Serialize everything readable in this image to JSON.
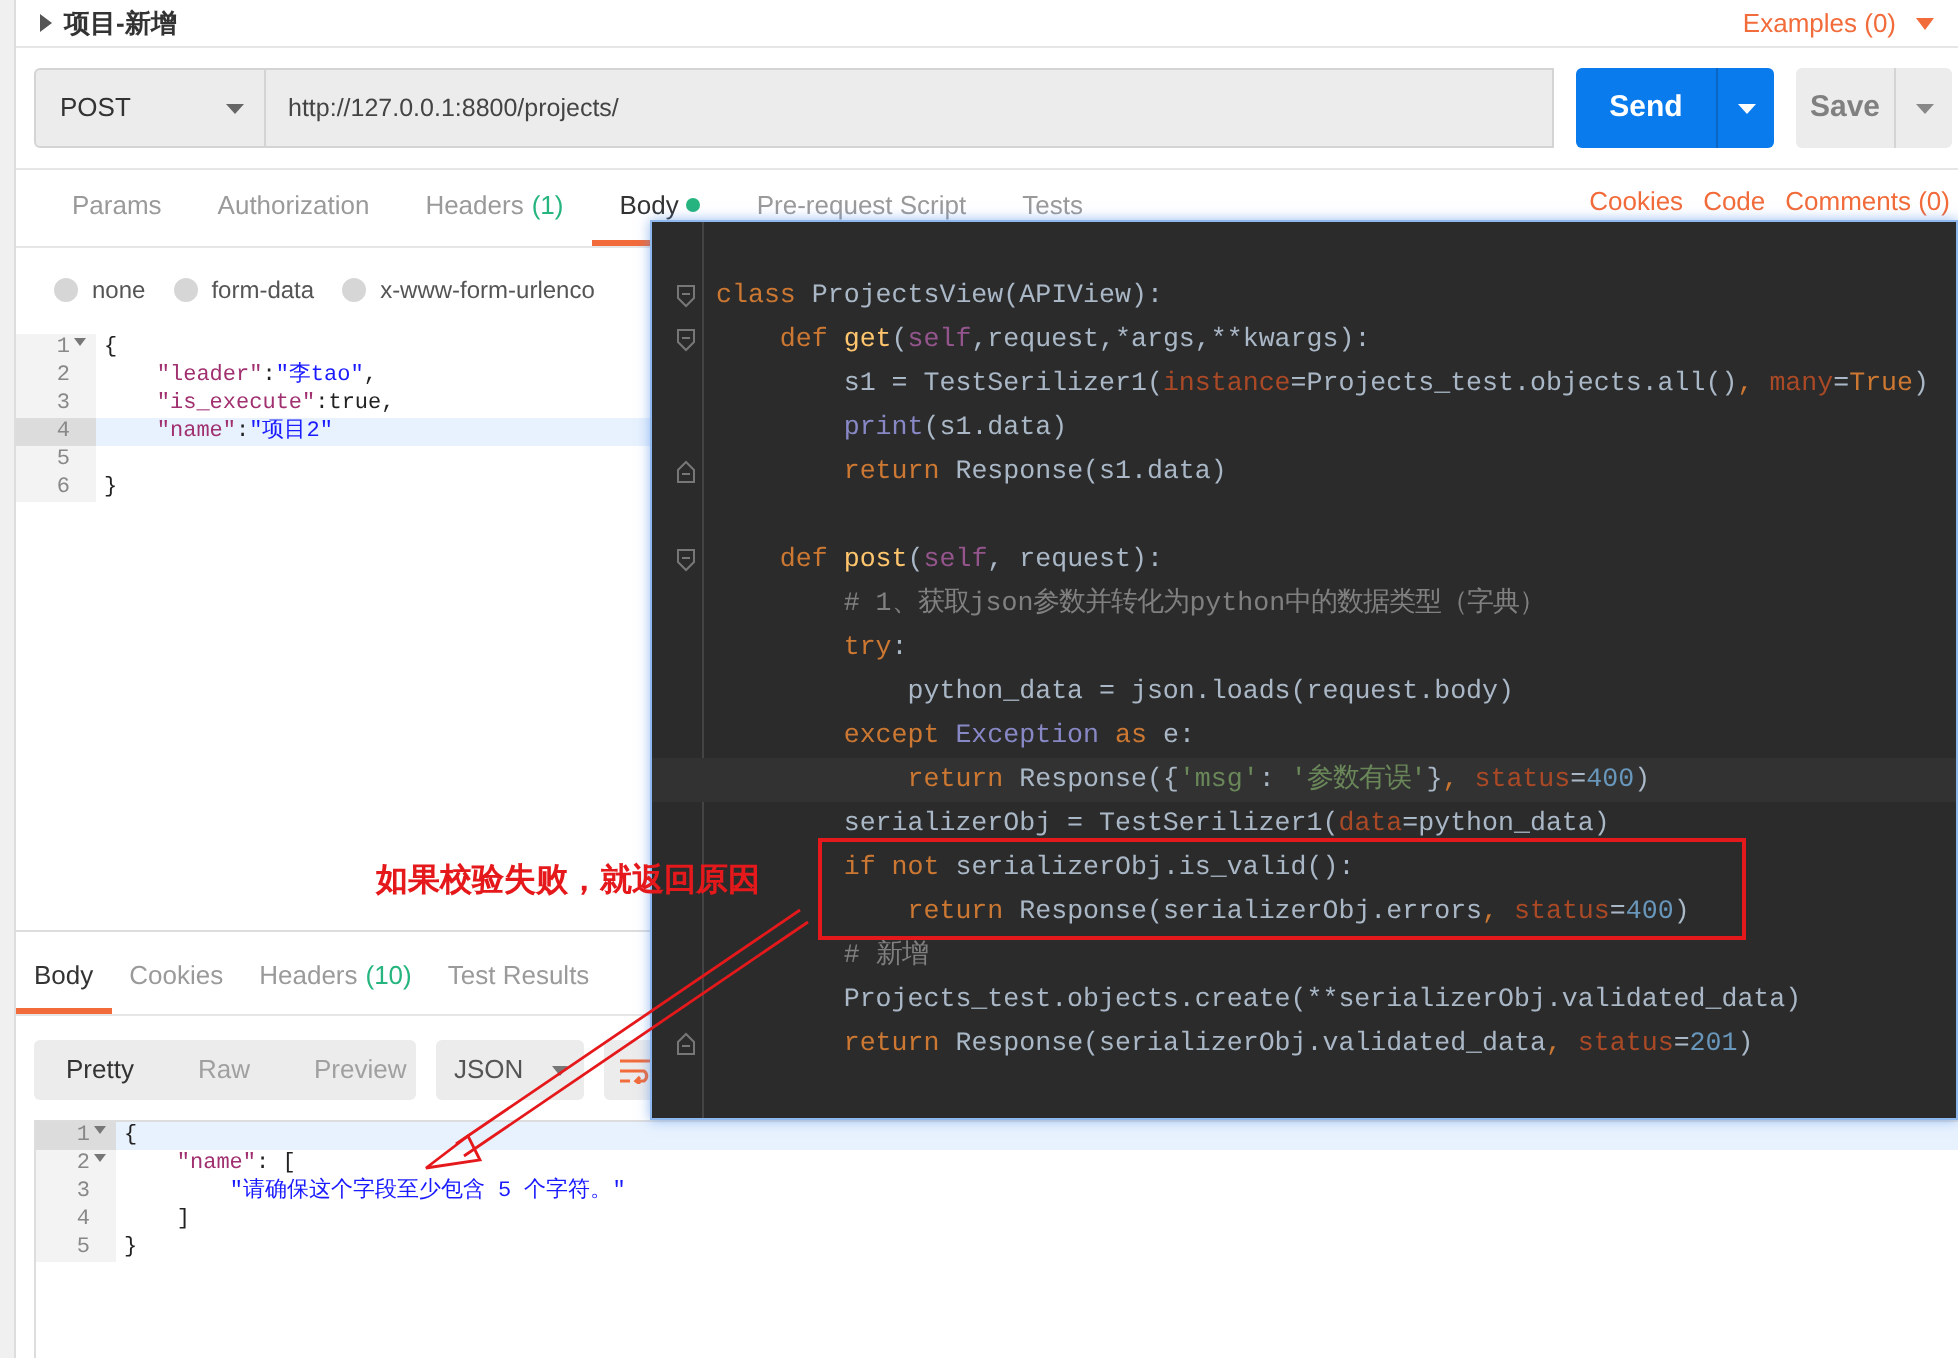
{
  "header": {
    "title": "项目-新增",
    "examples": "Examples (0)"
  },
  "request": {
    "method": "POST",
    "url": "http://127.0.0.1:8800/projects/",
    "send": "Send",
    "save": "Save"
  },
  "request_tabs": [
    {
      "label": "Params",
      "selected": false
    },
    {
      "label": "Authorization",
      "selected": false
    },
    {
      "label": "Headers",
      "count": "(1)",
      "selected": false
    },
    {
      "label": "Body",
      "modified": true,
      "selected": true
    },
    {
      "label": "Pre-request Script",
      "selected": false
    },
    {
      "label": "Tests",
      "selected": false
    }
  ],
  "request_links": [
    "Cookies",
    "Code",
    "Comments (0)"
  ],
  "body_types": [
    {
      "label": "none",
      "selected": false
    },
    {
      "label": "form-data",
      "selected": false
    },
    {
      "label": "x-www-form-urlenco",
      "selected": false
    }
  ],
  "request_body": [
    {
      "number": "1",
      "foldable": true,
      "highlighted": false,
      "kind": "code",
      "tokens": [
        {
          "kind": "plain",
          "text": "{"
        }
      ]
    },
    {
      "number": "2",
      "foldable": false,
      "highlighted": false,
      "kind": "code",
      "tokens": [
        {
          "kind": "key",
          "text": "    \"leader\""
        },
        {
          "kind": "plain",
          "text": ":"
        },
        {
          "kind": "str",
          "text": "\"李tao\""
        },
        {
          "kind": "plain",
          "text": ","
        }
      ]
    },
    {
      "number": "3",
      "foldable": false,
      "highlighted": false,
      "kind": "code",
      "tokens": [
        {
          "kind": "key",
          "text": "    \"is_execute\""
        },
        {
          "kind": "plain",
          "text": ":true,"
        }
      ]
    },
    {
      "number": "4",
      "foldable": false,
      "highlighted": true,
      "kind": "code",
      "tokens": [
        {
          "kind": "key",
          "text": "    \"name\""
        },
        {
          "kind": "plain",
          "text": ":"
        },
        {
          "kind": "str",
          "text": "\"项目2\""
        }
      ]
    },
    {
      "number": "5",
      "foldable": false,
      "highlighted": false,
      "kind": "blank"
    },
    {
      "number": "6",
      "foldable": false,
      "highlighted": false,
      "kind": "code",
      "tokens": [
        {
          "kind": "plain",
          "text": "}"
        }
      ]
    }
  ],
  "response_tabs": [
    {
      "label": "Body",
      "selected": true
    },
    {
      "label": "Cookies",
      "selected": false
    },
    {
      "label": "Headers",
      "count": "(10)",
      "selected": false
    },
    {
      "label": "Test Results",
      "selected": false
    }
  ],
  "view_modes": [
    {
      "label": "Pretty",
      "selected": true
    },
    {
      "label": "Raw",
      "selected": false
    },
    {
      "label": "Preview",
      "selected": false
    }
  ],
  "format": "JSON",
  "response_body": [
    {
      "number": "1",
      "foldable": true,
      "highlighted": true,
      "kind": "code",
      "tokens": [
        {
          "kind": "plain",
          "text": "{"
        }
      ]
    },
    {
      "number": "2",
      "foldable": true,
      "highlighted": false,
      "kind": "code",
      "tokens": [
        {
          "kind": "key",
          "text": "    \"name\""
        },
        {
          "kind": "plain",
          "text": ": ["
        }
      ]
    },
    {
      "number": "3",
      "foldable": false,
      "highlighted": false,
      "kind": "code",
      "tokens": [
        {
          "kind": "str",
          "text": "        \"请确保这个字段至少包含 5 个字符。\""
        }
      ]
    },
    {
      "number": "4",
      "foldable": false,
      "highlighted": false,
      "kind": "code",
      "tokens": [
        {
          "kind": "plain",
          "text": "    ]"
        }
      ]
    },
    {
      "number": "5",
      "foldable": false,
      "highlighted": false,
      "kind": "code",
      "tokens": [
        {
          "kind": "plain",
          "text": "}"
        }
      ]
    }
  ],
  "ide_code": [
    {
      "kind": "opener",
      "highlighted": false,
      "tokens": [
        {
          "kind": "kw",
          "text": "class"
        },
        {
          "kind": "plain",
          "text": " ProjectsView(APIView):"
        }
      ]
    },
    {
      "kind": "opener",
      "highlighted": false,
      "tokens": [
        {
          "kind": "kw",
          "text": "    def "
        },
        {
          "kind": "fn",
          "text": "get"
        },
        {
          "kind": "plain",
          "text": "("
        },
        {
          "kind": "self",
          "text": "self"
        },
        {
          "kind": "plain",
          "text": ",request,*args,**kwargs):"
        }
      ]
    },
    {
      "kind": "code",
      "highlighted": false,
      "tokens": [
        {
          "kind": "plain",
          "text": "        s1 = TestSerilizer1("
        },
        {
          "kind": "param",
          "text": "instance"
        },
        {
          "kind": "plain",
          "text": "=Projects_test.objects.all()"
        },
        {
          "kind": "kw",
          "text": ", "
        },
        {
          "kind": "param",
          "text": "many"
        },
        {
          "kind": "plain",
          "text": "="
        },
        {
          "kind": "kw",
          "text": "True"
        },
        {
          "kind": "plain",
          "text": ")"
        }
      ]
    },
    {
      "kind": "code",
      "highlighted": false,
      "tokens": [
        {
          "kind": "builtin",
          "text": "        print"
        },
        {
          "kind": "plain",
          "text": "(s1.data)"
        }
      ]
    },
    {
      "kind": "closer",
      "highlighted": false,
      "tokens": [
        {
          "kind": "kw",
          "text": "        return"
        },
        {
          "kind": "plain",
          "text": " Response(s1.data)"
        }
      ]
    },
    {
      "kind": "blank",
      "highlighted": false
    },
    {
      "kind": "opener",
      "highlighted": false,
      "tokens": [
        {
          "kind": "kw",
          "text": "    def "
        },
        {
          "kind": "fn",
          "text": "post"
        },
        {
          "kind": "plain",
          "text": "("
        },
        {
          "kind": "self",
          "text": "self"
        },
        {
          "kind": "plain",
          "text": ", request):"
        }
      ]
    },
    {
      "kind": "code",
      "highlighted": false,
      "tokens": [
        {
          "kind": "comment",
          "text": "        # 1、获取json参数并转化为python中的数据类型（字典）"
        }
      ]
    },
    {
      "kind": "code",
      "highlighted": false,
      "tokens": [
        {
          "kind": "kw",
          "text": "        try"
        },
        {
          "kind": "plain",
          "text": ":"
        }
      ]
    },
    {
      "kind": "code",
      "highlighted": false,
      "tokens": [
        {
          "kind": "plain",
          "text": "            python_data = json.loads(request.body)"
        }
      ]
    },
    {
      "kind": "code",
      "highlighted": false,
      "tokens": [
        {
          "kind": "kw",
          "text": "        except "
        },
        {
          "kind": "builtin",
          "text": "Exception"
        },
        {
          "kind": "kw",
          "text": " as"
        },
        {
          "kind": "plain",
          "text": " e:"
        }
      ]
    },
    {
      "kind": "code",
      "highlighted": true,
      "tokens": [
        {
          "kind": "kw",
          "text": "            return"
        },
        {
          "kind": "plain",
          "text": " Response({"
        },
        {
          "kind": "str",
          "text": "'msg'"
        },
        {
          "kind": "plain",
          "text": ": "
        },
        {
          "kind": "str",
          "text": "'参数有误'"
        },
        {
          "kind": "plain",
          "text": "}"
        },
        {
          "kind": "kw",
          "text": ", "
        },
        {
          "kind": "param",
          "text": "status"
        },
        {
          "kind": "plain",
          "text": "="
        },
        {
          "kind": "num",
          "text": "400"
        },
        {
          "kind": "plain",
          "text": ")"
        }
      ]
    },
    {
      "kind": "code",
      "highlighted": false,
      "tokens": [
        {
          "kind": "plain",
          "text": "        serializerObj = TestSerilizer1("
        },
        {
          "kind": "param",
          "text": "data"
        },
        {
          "kind": "plain",
          "text": "=python_data)"
        }
      ]
    },
    {
      "kind": "code",
      "highlighted": false,
      "tokens": [
        {
          "kind": "kw",
          "text": "        if not"
        },
        {
          "kind": "plain",
          "text": " serializerObj.is_valid():"
        }
      ]
    },
    {
      "kind": "code",
      "highlighted": false,
      "tokens": [
        {
          "kind": "kw",
          "text": "            return"
        },
        {
          "kind": "plain",
          "text": " Response(serializerObj.errors"
        },
        {
          "kind": "kw",
          "text": ", "
        },
        {
          "kind": "param",
          "text": "status"
        },
        {
          "kind": "plain",
          "text": "="
        },
        {
          "kind": "num",
          "text": "400"
        },
        {
          "kind": "plain",
          "text": ")"
        }
      ]
    },
    {
      "kind": "code",
      "highlighted": false,
      "tokens": [
        {
          "kind": "comment",
          "text": "        # 新增"
        }
      ]
    },
    {
      "kind": "code",
      "highlighted": false,
      "tokens": [
        {
          "kind": "plain",
          "text": "        Projects_test.objects.create(**serializerObj.validated_data)"
        }
      ]
    },
    {
      "kind": "closer",
      "highlighted": false,
      "tokens": [
        {
          "kind": "kw",
          "text": "        return"
        },
        {
          "kind": "plain",
          "text": " Response(serializerObj.validated_data"
        },
        {
          "kind": "kw",
          "text": ", "
        },
        {
          "kind": "param",
          "text": "status"
        },
        {
          "kind": "plain",
          "text": "="
        },
        {
          "kind": "num",
          "text": "201"
        },
        {
          "kind": "plain",
          "text": ")"
        }
      ]
    }
  ],
  "annotation": {
    "text": "如果校验失败，就返回原因"
  }
}
